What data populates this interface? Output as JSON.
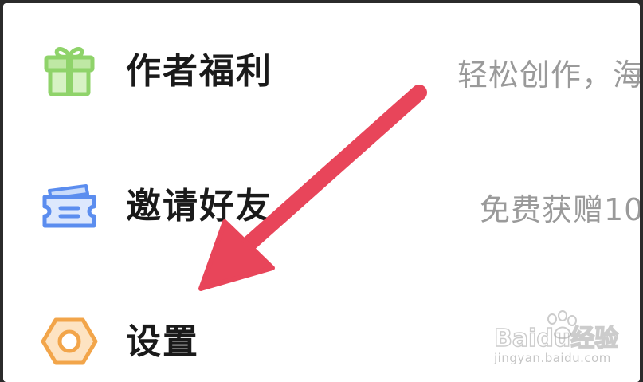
{
  "menu": {
    "items": [
      {
        "label": "作者福利",
        "description": "轻松创作，海",
        "icon": "gift-icon",
        "icon_color": "#8fd36a"
      },
      {
        "label": "邀请好友",
        "description": "免费获赠10",
        "icon": "ticket-icon",
        "icon_color": "#5b8def"
      },
      {
        "label": "设置",
        "description": "",
        "icon": "settings-hexagon-icon",
        "icon_color": "#f2a54a"
      }
    ]
  },
  "annotation": {
    "arrow_color": "#e8455a"
  },
  "watermark": {
    "brand": "Baidu经验",
    "url": "jingyan.baidu.com"
  }
}
